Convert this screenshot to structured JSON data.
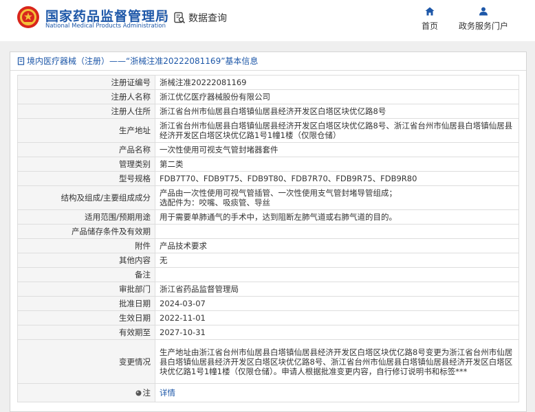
{
  "header": {
    "site_title": "国家药品监督管理局",
    "site_subtitle": "National Medical Products Administration",
    "data_query": "数据查询",
    "nav": {
      "home": "首页",
      "portal": "政务服务门户"
    },
    "brand_color": "#1d57a8"
  },
  "panel": {
    "title": "境内医疗器械（注册）——“浙械注准20222081169”基本信息"
  },
  "rows": [
    {
      "label": "注册证编号",
      "value": "浙械注准20222081169"
    },
    {
      "label": "注册人名称",
      "value": "浙江优亿医疗器械股份有限公司"
    },
    {
      "label": "注册人住所",
      "value": "浙江省台州市仙居县白塔镇仙居县经济开发区白塔区块优亿路8号"
    },
    {
      "label": "生产地址",
      "value": "浙江省台州市仙居县白塔镇仙居县经济开发区白塔区块优亿路8号、浙江省台州市仙居县白塔镇仙居县经济开发区白塔区块优亿路1号1幢1楼（仅限仓储）"
    },
    {
      "label": "产品名称",
      "value": "一次性使用可视支气管封堵器套件"
    },
    {
      "label": "管理类别",
      "value": "第二类"
    },
    {
      "label": "型号规格",
      "value": "FDB7T70、FDB9T75、FDB9T80、FDB7R70、FDB9R75、FDB9R80"
    },
    {
      "label": "结构及组成/主要组成成分",
      "value_line1": "产品由一次性使用可视气管插管、一次性使用支气管封堵导管组成；",
      "value_line2": "选配件为：咬嘴、吸痰管、导丝"
    },
    {
      "label": "适用范围/预期用途",
      "value": "用于需要单肺通气的手术中，达到阻断左肺气道或右肺气道的目的。"
    },
    {
      "label": "产品储存条件及有效期",
      "value": ""
    },
    {
      "label": "附件",
      "value": "产品技术要求"
    },
    {
      "label": "其他内容",
      "value": "无"
    },
    {
      "label": "备注",
      "value": ""
    },
    {
      "label": "审批部门",
      "value": "浙江省药品监督管理局"
    },
    {
      "label": "批准日期",
      "value": "2024-03-07"
    },
    {
      "label": "生效日期",
      "value": "2022-11-01"
    },
    {
      "label": "有效期至",
      "value": "2027-10-31"
    },
    {
      "label": "变更情况",
      "value": "生产地址由浙江省台州市仙居县白塔镇仙居县经济开发区白塔区块优亿路8号变更为浙江省台州市仙居县白塔镇仙居县经济开发区白塔区块优亿路8号、浙江省台州市仙居县白塔镇仙居县经济开发区白塔区块优亿路1号1幢1楼（仅限仓储）。申请人根据批准变更内容，自行修订说明书和标签***"
    },
    {
      "label": "注",
      "value": "详情"
    }
  ]
}
